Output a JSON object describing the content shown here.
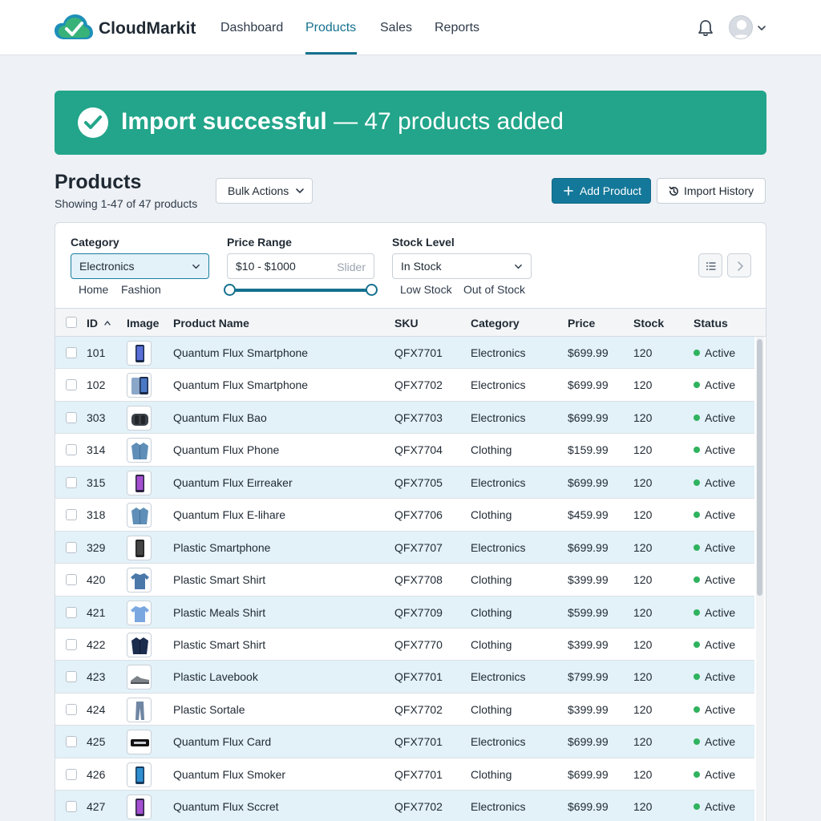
{
  "app": {
    "brand": "CloudMarkit",
    "nav": [
      "Dashboard",
      "Products",
      "Sales",
      "Reports"
    ],
    "active_nav": "Products",
    "icons": [
      "cloud-check-logo",
      "bell-icon",
      "user-avatar",
      "chevron-down-icon"
    ]
  },
  "banner": {
    "bold": "Import successful",
    "rest": " — 47 products added",
    "color": "#22a58a"
  },
  "products": {
    "title": "Products",
    "subtitle": "Showing 1-47 of 47 products",
    "bulk_actions": "Bulk Actions",
    "add_product": "Add Product",
    "import_history": "Import History"
  },
  "filters": {
    "category": {
      "label": "Category",
      "value": "Electronics",
      "options": [
        "Home",
        "Fashion"
      ]
    },
    "price": {
      "label": "Price Range",
      "value": "$10 - $1000",
      "hint": "Slider"
    },
    "stock": {
      "label": "Stock Level",
      "value": "In Stock",
      "options": [
        "Low Stock",
        "Out of Stock"
      ]
    }
  },
  "table": {
    "columns": [
      "ID",
      "Image",
      "Product Name",
      "SKU",
      "Category",
      "Price",
      "Stock",
      "Status"
    ],
    "sort": {
      "column": "ID",
      "direction": "ascending"
    },
    "rows": [
      {
        "id": "101",
        "name": "Quantum Flux Smartphone",
        "sku": "QFX7701",
        "category": "Electronics",
        "price": "$699.99",
        "stock": "120",
        "status": "Active",
        "image": "phone"
      },
      {
        "id": "102",
        "name": "Quantum Flux Smartphone",
        "sku": "QFX7702",
        "category": "Electronics",
        "price": "$699.99",
        "stock": "120",
        "status": "Active",
        "image": "phone-pair"
      },
      {
        "id": "303",
        "name": "Quantum Flux Bao",
        "sku": "QFX7703",
        "category": "Electronics",
        "price": "$699.99",
        "stock": "120",
        "status": "Active",
        "image": "bag"
      },
      {
        "id": "314",
        "name": "Quantum Flux Phone",
        "sku": "QFX7704",
        "category": "Clothing",
        "price": "$159.99",
        "stock": "120",
        "status": "Active",
        "image": "jacket"
      },
      {
        "id": "315",
        "name": "Quantum Flux Eιrreaker",
        "sku": "QFX7705",
        "category": "Electronics",
        "price": "$699.99",
        "stock": "120",
        "status": "Active",
        "image": "phone-purple"
      },
      {
        "id": "318",
        "name": "Quantum Flux E-lihare",
        "sku": "QFX7706",
        "category": "Clothing",
        "price": "$459.99",
        "stock": "120",
        "status": "Active",
        "image": "jacket"
      },
      {
        "id": "329",
        "name": "Plastic Smartphone",
        "sku": "QFX7707",
        "category": "Electronics",
        "price": "$699.99",
        "stock": "120",
        "status": "Active",
        "image": "phone-dark"
      },
      {
        "id": "420",
        "name": "Plastic Smart Shirt",
        "sku": "QFX7708",
        "category": "Clothing",
        "price": "$399.99",
        "stock": "120",
        "status": "Active",
        "image": "shirt"
      },
      {
        "id": "421",
        "name": "Plastic Meals Shirt",
        "sku": "QFX7709",
        "category": "Clothing",
        "price": "$599.99",
        "stock": "120",
        "status": "Active",
        "image": "shirt-light"
      },
      {
        "id": "422",
        "name": "Plastic Smart Shirt",
        "sku": "QFX7770",
        "category": "Clothing",
        "price": "$399.99",
        "stock": "120",
        "status": "Active",
        "image": "jacket-navy"
      },
      {
        "id": "423",
        "name": "Plastic Lavebook",
        "sku": "QFX7701",
        "category": "Electronics",
        "price": "$799.99",
        "stock": "120",
        "status": "Active",
        "image": "shoe"
      },
      {
        "id": "424",
        "name": "Plastic Sortale",
        "sku": "QFX7702",
        "category": "Clothing",
        "price": "$399.99",
        "stock": "120",
        "status": "Active",
        "image": "jeans"
      },
      {
        "id": "425",
        "name": "Quantum Flux Card",
        "sku": "QFX7701",
        "category": "Electronics",
        "price": "$699.99",
        "stock": "120",
        "status": "Active",
        "image": "card"
      },
      {
        "id": "426",
        "name": "Quantum Flux Smoker",
        "sku": "QFX7701",
        "category": "Clothing",
        "price": "$699.99",
        "stock": "120",
        "status": "Active",
        "image": "phone-blue"
      },
      {
        "id": "427",
        "name": "Quantum Flux Sccret",
        "sku": "QFX7702",
        "category": "Electronics",
        "price": "$699.99",
        "stock": "120",
        "status": "Active",
        "image": "phone-purple"
      }
    ]
  },
  "colors": {
    "accent": "#15718f",
    "primary_button": "#14789a",
    "row_highlight": "#e3f1f8",
    "active_dot": "#2fb35e"
  }
}
